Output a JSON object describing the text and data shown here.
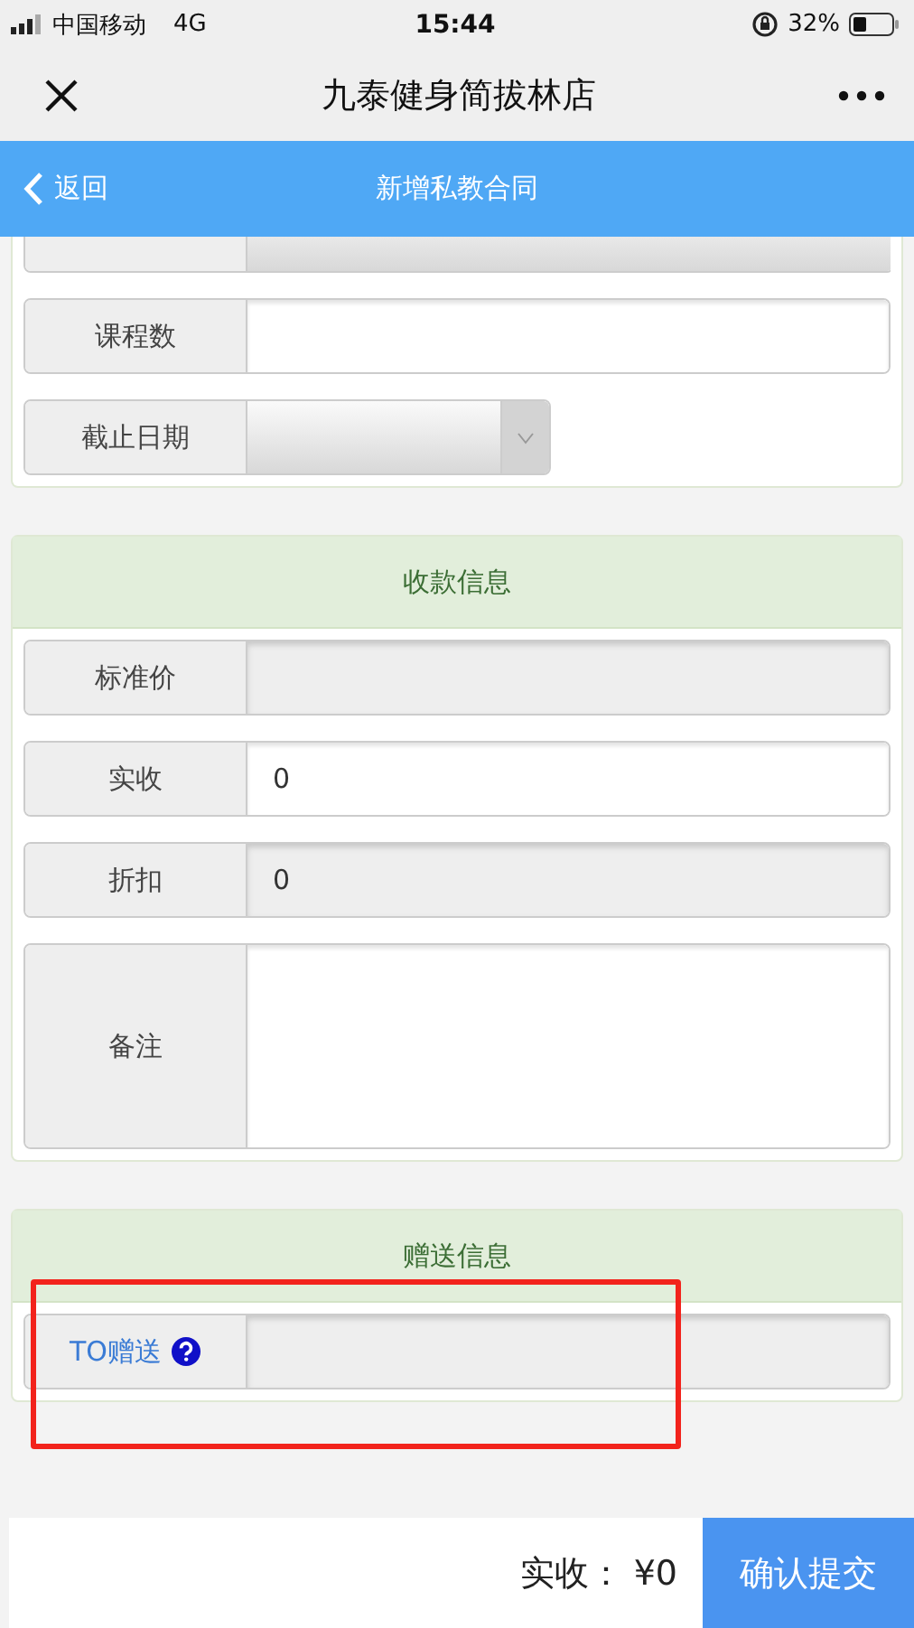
{
  "status_bar": {
    "carrier": "中国移动",
    "network": "4G",
    "time": "15:44",
    "battery": "32%"
  },
  "nav_bar": {
    "title": "九泰健身简拔林店"
  },
  "header": {
    "back": "返回",
    "title": "新增私教合同"
  },
  "sections": [
    {
      "rows": [
        {
          "kind": "cut"
        },
        {
          "kind": "input",
          "label": "课程数"
        },
        {
          "kind": "select",
          "label": "截止日期"
        }
      ]
    },
    {
      "title": "收款信息",
      "rows": [
        {
          "kind": "readonly",
          "label": "标准价"
        },
        {
          "kind": "input",
          "label": "实收",
          "value": "0"
        },
        {
          "kind": "readonly",
          "label": "折扣",
          "value": "0"
        },
        {
          "kind": "textarea",
          "label": "备注"
        }
      ]
    },
    {
      "title": "赠送信息",
      "highlighted": true,
      "rows": [
        {
          "kind": "readonly",
          "label": "TO赠送",
          "help": true,
          "link": true
        }
      ]
    }
  ],
  "footer": {
    "total": "实收： ¥0",
    "submit": "确认提交"
  }
}
